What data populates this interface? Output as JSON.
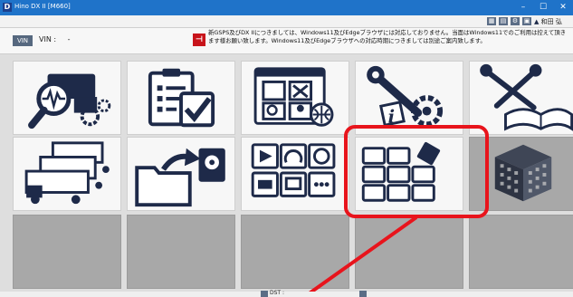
{
  "window": {
    "title": "Hino DX II [M660]",
    "app_icon_letter": "D",
    "minimize": "–",
    "maximize": "☐",
    "close": "✕"
  },
  "toolbar": {
    "user_name": "和田 弘"
  },
  "infobar": {
    "vin_badge": "VIN",
    "vin_label": "VIN :",
    "vin_value": "-",
    "notice": "新GSPS及びDX IIにつきましては、Windows11及びEdgeブラウザには対応しておりません。当面はWindows11でのご利用は控えて頂きます様お願い致します。Windows11及びEdgeブラウザへの対応時期につきましては別途ご案内致します。"
  },
  "tiles": [
    {
      "name": "diagnosis-tile",
      "icon": "truck-magnifier-gear-icon"
    },
    {
      "name": "checklist-tile",
      "icon": "clipboard-checklist-icon"
    },
    {
      "name": "tools-window-tile",
      "icon": "app-window-tools-icon"
    },
    {
      "name": "service-info-tile",
      "icon": "wrench-gear-info-icon"
    },
    {
      "name": "manual-tile",
      "icon": "tools-book-icon"
    },
    {
      "name": "fleet-tile",
      "icon": "multiple-trucks-icon"
    },
    {
      "name": "data-export-tile",
      "icon": "folder-disk-arrow-icon"
    },
    {
      "name": "vehicle-functions-tile",
      "icon": "vehicle-function-grid-icon"
    },
    {
      "name": "apps-tile",
      "icon": "app-grid-diamond-icon"
    },
    {
      "name": "cube-tile",
      "icon": "cube-icon"
    }
  ],
  "statusbar": {
    "label": "DST :"
  },
  "colors": {
    "title_bar": "#1f73c9",
    "icon_navy": "#1e2a49",
    "highlight_red": "#e8141c",
    "empty_tile": "#a8a8a8"
  }
}
